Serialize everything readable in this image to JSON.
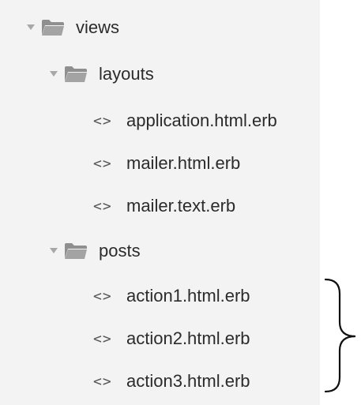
{
  "tree": {
    "root": {
      "label": "views",
      "icon": "folder-open-icon",
      "toggle_icon": "triangle-down-icon",
      "children": [
        {
          "label": "layouts",
          "icon": "folder-open-icon",
          "toggle_icon": "triangle-down-icon",
          "files": [
            {
              "label": "application.html.erb",
              "icon": "code-file-icon"
            },
            {
              "label": "mailer.html.erb",
              "icon": "code-file-icon"
            },
            {
              "label": "mailer.text.erb",
              "icon": "code-file-icon"
            }
          ]
        },
        {
          "label": "posts",
          "icon": "folder-open-icon",
          "toggle_icon": "triangle-down-icon",
          "files": [
            {
              "label": "action1.html.erb",
              "icon": "code-file-icon"
            },
            {
              "label": "action2.html.erb",
              "icon": "code-file-icon"
            },
            {
              "label": "action3.html.erb",
              "icon": "code-file-icon"
            }
          ]
        }
      ]
    },
    "file_icon_glyph": "<>",
    "annotation": {
      "icon": "curly-brace-icon"
    }
  },
  "colors": {
    "panel_background": "#f3f3f3",
    "text": "#2b2b2b",
    "folder": "#9a9a9a",
    "toggle": "#a8a8a8"
  }
}
